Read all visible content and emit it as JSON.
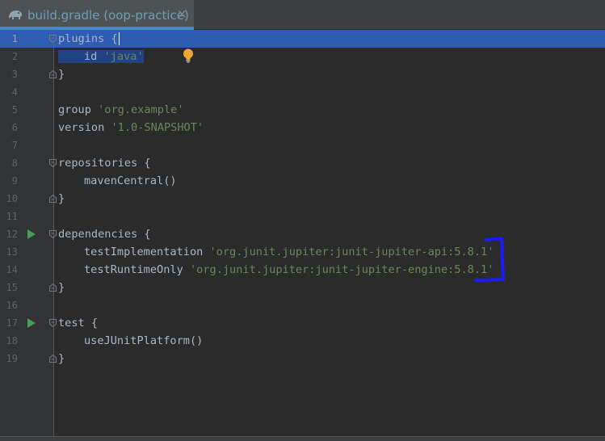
{
  "tab": {
    "title": "build.gradle (oop-practice)",
    "close": "×",
    "icon": "gradle-elephant-icon"
  },
  "lines": [
    {
      "n": "1"
    },
    {
      "n": "2"
    },
    {
      "n": "3"
    },
    {
      "n": "4"
    },
    {
      "n": "5"
    },
    {
      "n": "6"
    },
    {
      "n": "7"
    },
    {
      "n": "8"
    },
    {
      "n": "9"
    },
    {
      "n": "10"
    },
    {
      "n": "11"
    },
    {
      "n": "12"
    },
    {
      "n": "13"
    },
    {
      "n": "14"
    },
    {
      "n": "15"
    },
    {
      "n": "16"
    },
    {
      "n": "17"
    },
    {
      "n": "18"
    },
    {
      "n": "19"
    }
  ],
  "code": {
    "plugins": "plugins {",
    "id_kw": "id ",
    "id_val": "'java'",
    "close": "}",
    "group_kw": "group ",
    "group_val": "'org.example'",
    "version_kw": "version ",
    "version_val": "'1.0-SNAPSHOT'",
    "repositories": "repositories {",
    "maven": "mavenCentral()",
    "dependencies": "dependencies {",
    "testImpl_kw": "testImplementation ",
    "testImpl_val": "'org.junit.jupiter:junit-jupiter-api:5.8.1'",
    "testRt_kw": "testRuntimeOnly ",
    "testRt_val": "'org.junit.jupiter:junit-jupiter-engine:5.8.1'",
    "test": "test {",
    "useJUnit": "useJUnitPlatform()"
  },
  "colors": {
    "keyword": "#a9b7c6",
    "string": "#6a8759",
    "selection": "#214283",
    "current_line": "#2f65ca",
    "run_icon": "#499c54",
    "annotation": "#1a1aff"
  }
}
